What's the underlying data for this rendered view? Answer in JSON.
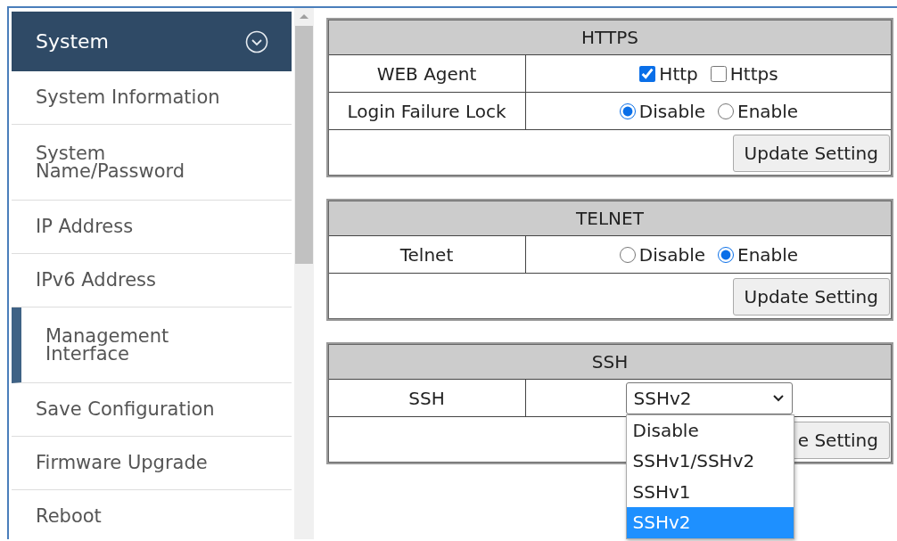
{
  "sidebar": {
    "header": {
      "label": "System",
      "expanded": true
    },
    "items": [
      {
        "label": "System Information",
        "selected": false
      },
      {
        "label": "System Name/Password",
        "selected": false
      },
      {
        "label": "IP Address",
        "selected": false
      },
      {
        "label": "IPv6 Address",
        "selected": false
      },
      {
        "label": "Management Interface",
        "selected": true
      },
      {
        "label": "Save Configuration",
        "selected": false
      },
      {
        "label": "Firmware Upgrade",
        "selected": false
      },
      {
        "label": "Reboot",
        "selected": false
      }
    ]
  },
  "sections": [
    {
      "title": "HTTPS",
      "rows": [
        {
          "label": "WEB Agent",
          "kind": "checkboxes",
          "options": [
            {
              "label": "Http",
              "checked": true
            },
            {
              "label": "Https",
              "checked": false
            }
          ]
        },
        {
          "label": "Login Failure Lock",
          "kind": "radios",
          "options": [
            {
              "label": "Disable",
              "selected": true
            },
            {
              "label": "Enable",
              "selected": false
            }
          ]
        }
      ],
      "button": "Update Setting"
    },
    {
      "title": "TELNET",
      "rows": [
        {
          "label": "Telnet",
          "kind": "radios",
          "options": [
            {
              "label": "Disable",
              "selected": false
            },
            {
              "label": "Enable",
              "selected": true
            }
          ]
        }
      ],
      "button": "Update Setting"
    },
    {
      "title": "SSH",
      "rows": [
        {
          "label": "SSH",
          "kind": "select",
          "value": "SSHv2",
          "expanded": true,
          "options": [
            {
              "label": "Disable",
              "selected": false
            },
            {
              "label": "SSHv1/SSHv2",
              "selected": false
            },
            {
              "label": "SSHv1",
              "selected": false
            },
            {
              "label": "SSHv2",
              "selected": true
            }
          ]
        }
      ],
      "button": "e Setting"
    }
  ]
}
